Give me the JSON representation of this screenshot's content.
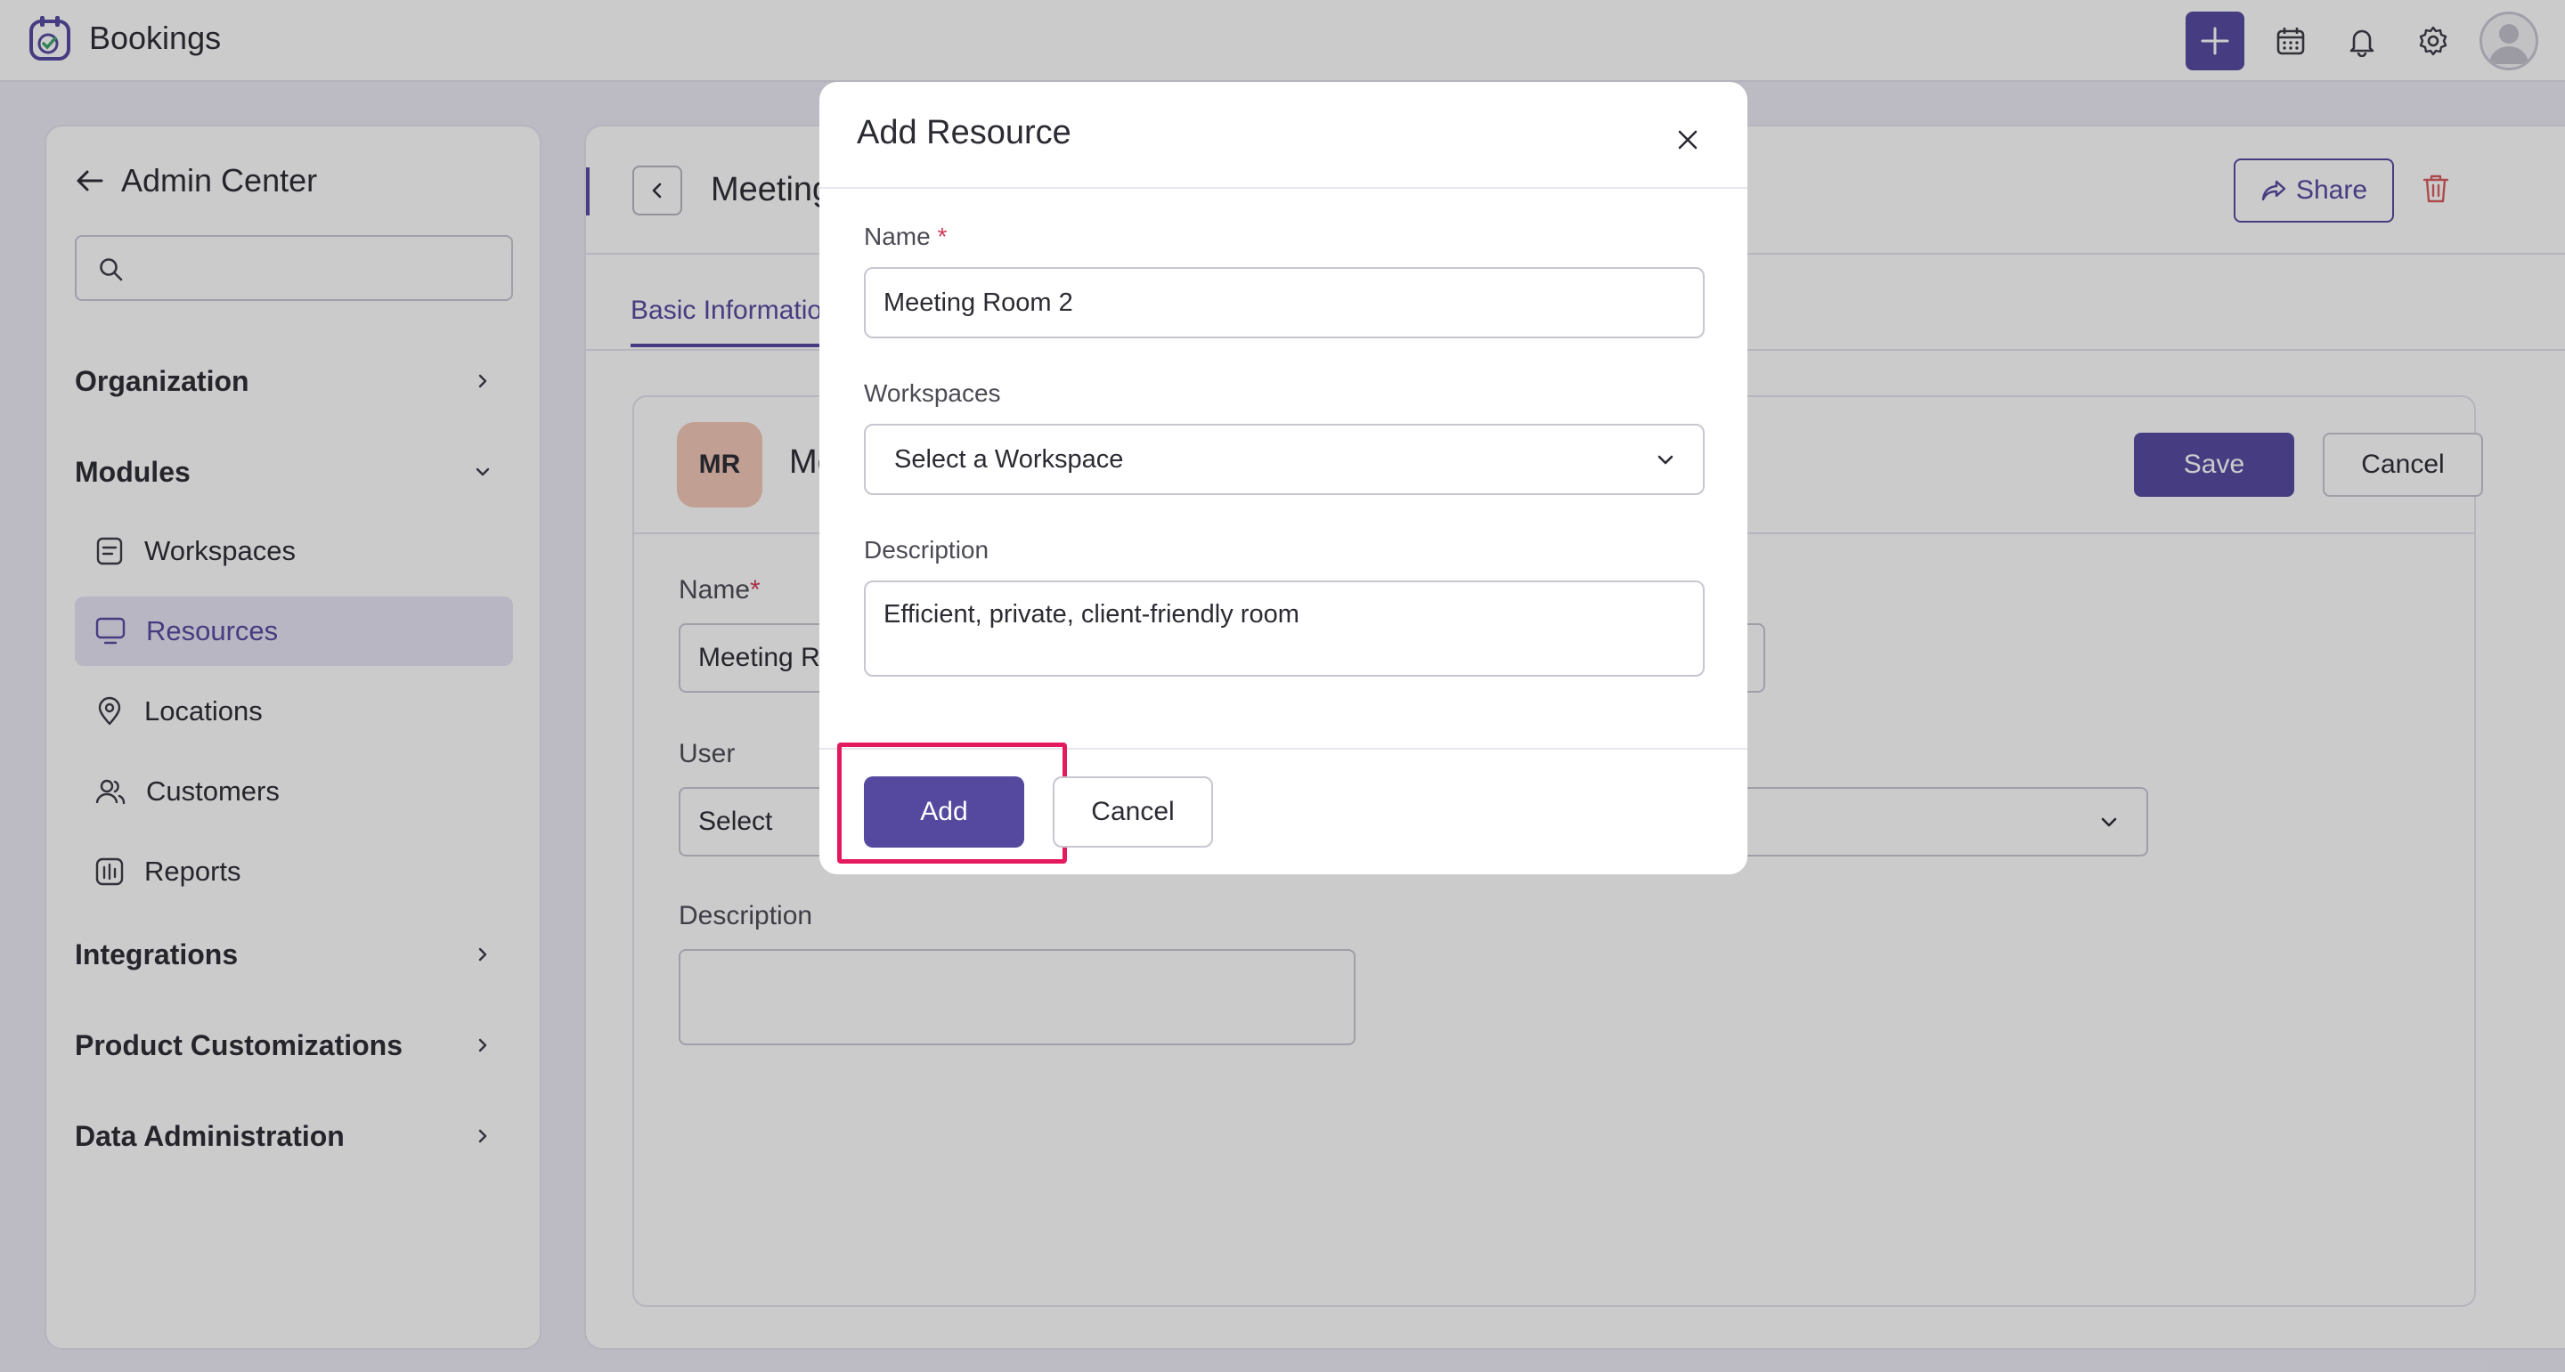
{
  "app": {
    "name": "Bookings"
  },
  "topbar": {
    "icons": [
      "add-icon",
      "calendar-icon",
      "bell-icon",
      "gear-icon",
      "user-avatar-icon"
    ]
  },
  "sidebar": {
    "title": "Admin Center",
    "search_value": "",
    "sections": {
      "organization": "Organization",
      "modules": "Modules",
      "integrations": "Integrations",
      "product_customizations": "Product Customizations",
      "data_administration": "Data Administration"
    },
    "module_items": [
      {
        "label": "Workspaces",
        "icon": "workspace-icon"
      },
      {
        "label": "Resources",
        "icon": "monitor-icon",
        "active": true
      },
      {
        "label": "Locations",
        "icon": "location-pin-icon"
      },
      {
        "label": "Customers",
        "icon": "users-icon"
      },
      {
        "label": "Reports",
        "icon": "report-icon"
      }
    ]
  },
  "main": {
    "title": "Meeting",
    "share_label": "Share",
    "tab_label": "Basic Informatio",
    "card": {
      "avatar_initials": "MR",
      "name_partial": "Me",
      "save_label": "Save",
      "cancel_label": "Cancel",
      "name_label": "Name",
      "name_value": "Meeting Ro",
      "user_label": "User",
      "user_value": "Select",
      "description_label": "Description",
      "description_value": ""
    }
  },
  "modal": {
    "title": "Add Resource",
    "name_label": "Name",
    "required_mark": "*",
    "name_value": "Meeting Room 2",
    "workspaces_label": "Workspaces",
    "workspaces_value": "Select a Workspace",
    "description_label": "Description",
    "description_value": "Efficient, private, client-friendly room",
    "add_label": "Add",
    "cancel_label": "Cancel"
  },
  "colors": {
    "accent": "#55489f",
    "highlight": "#e5195e",
    "avatar_bg": "#f2c7b5",
    "danger": "#d13a55"
  }
}
